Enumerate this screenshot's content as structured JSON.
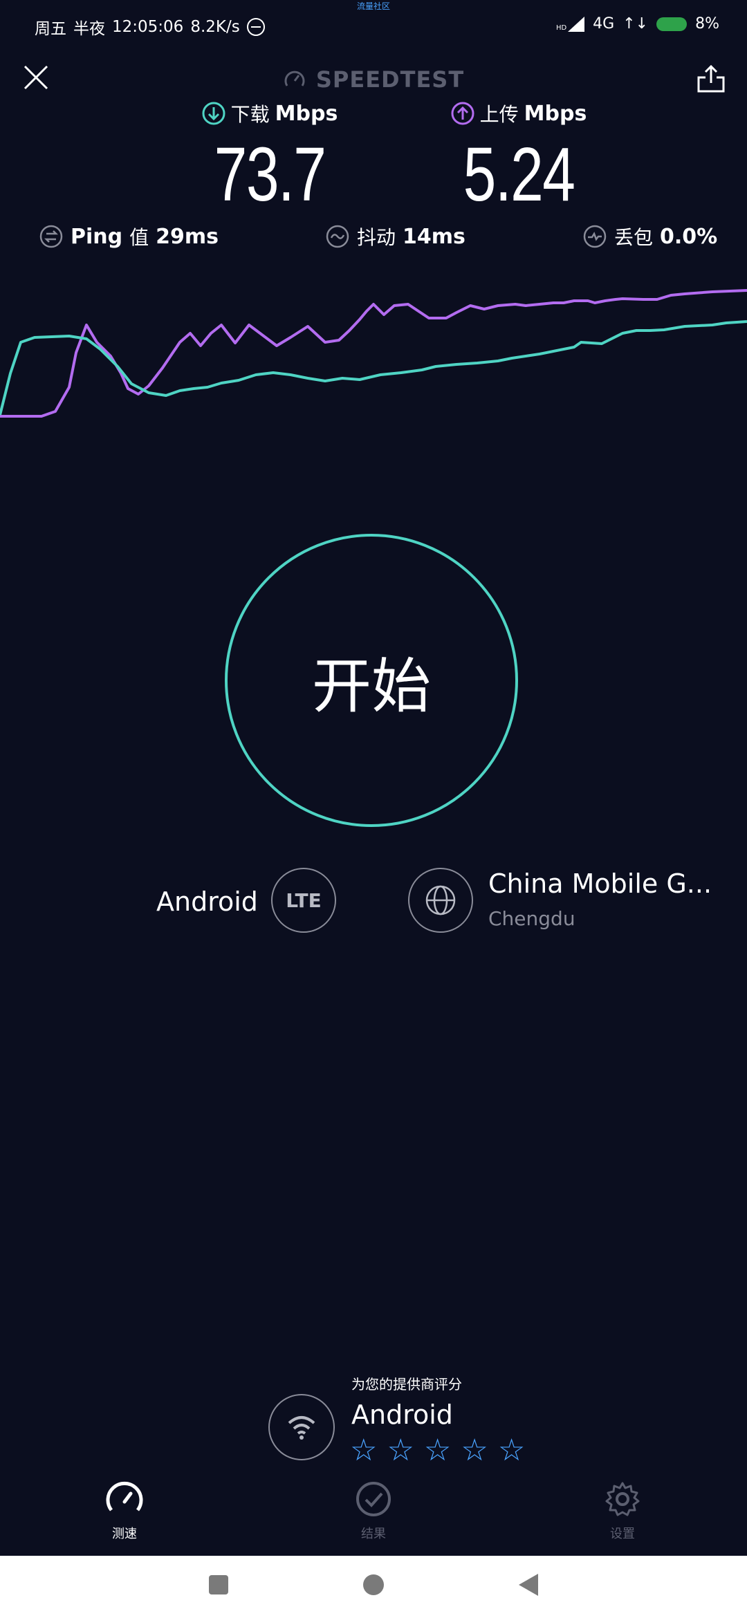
{
  "status_bar": {
    "day": "周五",
    "period": "半夜",
    "time": "12:05:06",
    "net_speed": "8.2K/s",
    "center_text": "流量社区",
    "hd": "HD",
    "network": "4G",
    "battery": "8%"
  },
  "header": {
    "brand": "SPEEDTEST"
  },
  "results": {
    "download": {
      "label": "下载",
      "unit": "Mbps",
      "value": "73.7"
    },
    "upload": {
      "label": "上传",
      "unit": "Mbps",
      "value": "5.24"
    },
    "ping": {
      "label": "Ping",
      "label_zh": "值",
      "value": "29ms"
    },
    "jitter": {
      "label": "抖动",
      "value": "14ms"
    },
    "loss": {
      "label": "丢包",
      "value": "0.0%"
    }
  },
  "start_button": {
    "label": "开始"
  },
  "device": {
    "name": "Android",
    "badge": "LTE"
  },
  "server": {
    "name": "China Mobile G...",
    "location": "Chengdu"
  },
  "rating": {
    "prompt": "为您的提供商评分",
    "provider": "Android",
    "stars": [
      "☆",
      "☆",
      "☆",
      "☆",
      "☆"
    ]
  },
  "nav": {
    "speed": "测速",
    "results": "结果",
    "settings": "设置"
  },
  "colors": {
    "background": "#0b0e1f",
    "download": "#4fd4c4",
    "upload": "#b36cf0",
    "star": "#4aa3ff"
  }
}
